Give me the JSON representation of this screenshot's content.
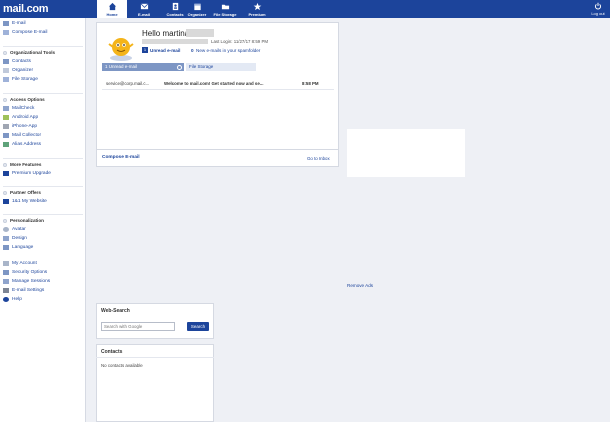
{
  "app": {
    "logo": "mail.com"
  },
  "topnav": {
    "items": [
      {
        "label": "Home"
      },
      {
        "label": "E-mail"
      },
      {
        "label": "Contacts"
      },
      {
        "label": "Organizer"
      },
      {
        "label": "File Storage"
      },
      {
        "label": "Premium"
      }
    ],
    "logout": "Log out"
  },
  "sidebar": {
    "email": "E-mail",
    "compose": "Compose E-mail",
    "org_head": "Organizational Tools",
    "contacts": "Contacts",
    "organizer": "Organizer",
    "file_storage": "File Storage",
    "access_head": "Access Options",
    "mailcheck": "MailCheck",
    "android": "Android App",
    "iphone": "iPhone-App",
    "mail_collector": "Mail Collector",
    "alias": "Alias Address",
    "more_head": "More Features",
    "premium_upgrade": "Premium Upgrade",
    "partner_head": "Partner Offers",
    "website": "1&1 My Website",
    "personal_head": "Personalization",
    "avatar": "Avatar",
    "design": "Design",
    "language": "Language",
    "my_account": "My Account",
    "security": "Security Options",
    "sessions": "Manage Sessions",
    "email_settings": "E-mail Settings",
    "help": "Help"
  },
  "welcome": {
    "greeting": "Hello martina",
    "last_login": "Last Login: 11/27/17 8:59 PM",
    "unread_count": "1",
    "unread_label": "Unread e-mail",
    "spam_count": "0",
    "spam_label": "New e-mails in your spamfolder",
    "tab_unread": "1 Unread e-mail",
    "tab_files": "File Storage",
    "mail": {
      "sender": "service@corp.mail.c...",
      "subject": "Welcome to mail.com! Get started now and se...",
      "time": "8:58 PM"
    },
    "compose_link": "Compose E-mail",
    "inbox_link": "Go to Inbox"
  },
  "ads": {
    "remove": "Remove Ads"
  },
  "websearch": {
    "title": "Web-Search",
    "placeholder": "Search with Google",
    "button": "Search"
  },
  "contacts_panel": {
    "title": "Contacts",
    "empty": "No contacts available"
  },
  "colors": {
    "brand": "#1c449b",
    "accent_tab": "#7d96c4"
  }
}
